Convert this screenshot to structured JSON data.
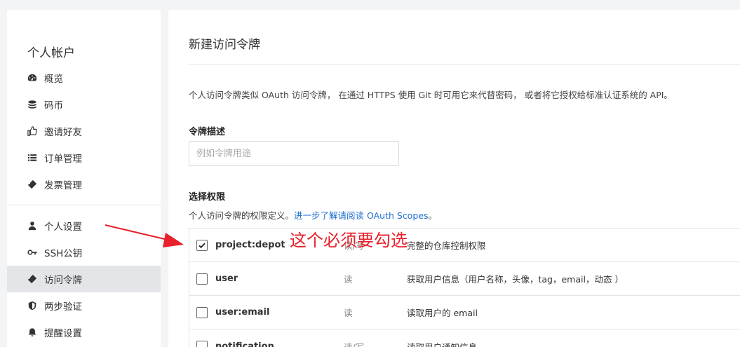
{
  "sidebar": {
    "title": "个人帐户",
    "items": [
      {
        "label": "概览",
        "icon": "dashboard-icon"
      },
      {
        "label": "码币",
        "icon": "coins-icon"
      },
      {
        "label": "邀请好友",
        "icon": "thumbs-up-icon"
      },
      {
        "label": "订单管理",
        "icon": "list-icon"
      },
      {
        "label": "发票管理",
        "icon": "ticket-icon"
      },
      {
        "label": "个人设置",
        "icon": "user-icon"
      },
      {
        "label": "SSH公钥",
        "icon": "key-icon"
      },
      {
        "label": "访问令牌",
        "icon": "ticket-icon",
        "active": true
      },
      {
        "label": "两步验证",
        "icon": "shield-icon"
      },
      {
        "label": "提醒设置",
        "icon": "bell-icon"
      }
    ]
  },
  "main": {
    "title": "新建访问令牌",
    "intro": "个人访问令牌类似 OAuth 访问令牌， 在通过 HTTPS 使用 Git 时可用它来代替密码， 或者将它授权给标准认证系统的 API。",
    "description_label": "令牌描述",
    "description_placeholder": "例如令牌用途",
    "scopes_label": "选择权限",
    "scopes_note_prefix": "个人访问令牌的权限定义。",
    "scopes_note_link": "进一步了解请阅读 OAuth Scopes",
    "scopes_note_suffix": "。",
    "scopes": [
      {
        "name": "project:depot",
        "perm": "读/写",
        "desc": "完整的仓库控制权限",
        "checked": true
      },
      {
        "name": "user",
        "perm": "读",
        "desc": "获取用户信息（用户名称，头像，tag，email，动态 ）",
        "checked": false
      },
      {
        "name": "user:email",
        "perm": "读",
        "desc": "读取用户的 email",
        "checked": false
      },
      {
        "name": "notification",
        "perm": "读/写",
        "desc": "读取用户通知信息",
        "checked": false
      }
    ]
  },
  "annotation": {
    "text": "这个必须要勾选",
    "color": "#e8202a"
  },
  "colors": {
    "link": "#1f6fd0",
    "active_bg": "#e3e5e9"
  }
}
